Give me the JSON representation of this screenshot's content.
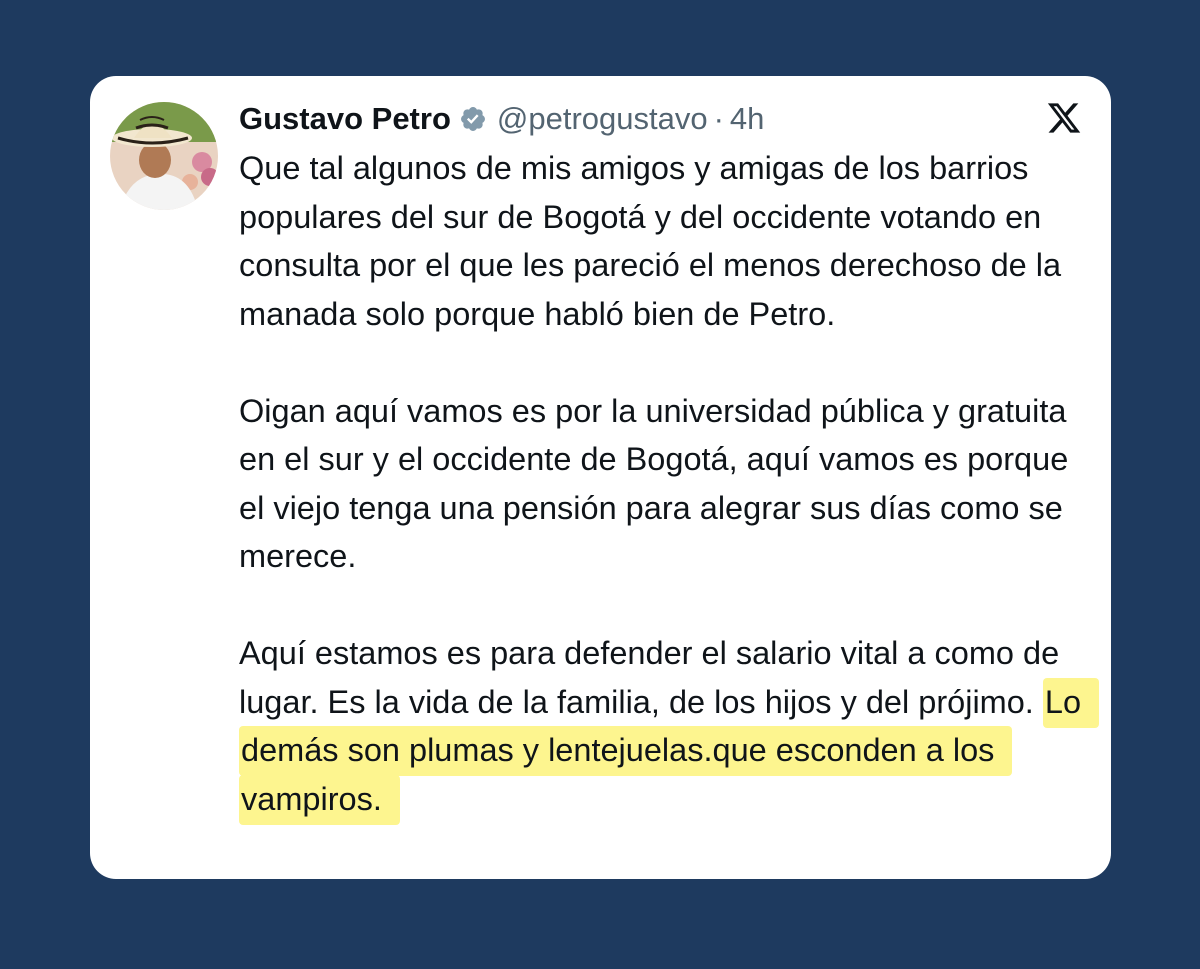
{
  "tweet": {
    "author_name": "Gustavo Petro",
    "handle": "@petrogustavo",
    "separator": "·",
    "time": "4h",
    "paragraph1": "Que tal algunos de mis amigos y amigas de los barrios populares del sur de Bogotá y del occidente votando en consulta por el que les pareció el menos derechoso de la manada solo porque habló bien de Petro.",
    "paragraph2": "Oigan aquí vamos es por la universidad pública y gratuita en el sur y el occidente de Bogotá, aquí vamos es porque el viejo tenga una pensión para alegrar sus días como se merece.",
    "paragraph3_start": "Aquí estamos es para defender el salario vital a como de lugar. Es la vida de la familia, de los hijos y del prójimo.",
    "paragraph3_highlighted": "Lo demás son plumas y lentejuelas.que esconden a los vampiros."
  },
  "icons": {
    "verified": "verified-badge-icon",
    "platform": "x-logo-icon"
  },
  "colors": {
    "background": "#1e3a5f",
    "card": "#ffffff",
    "highlight": "#fdf58f",
    "text": "#0f1419",
    "muted": "#536471"
  }
}
